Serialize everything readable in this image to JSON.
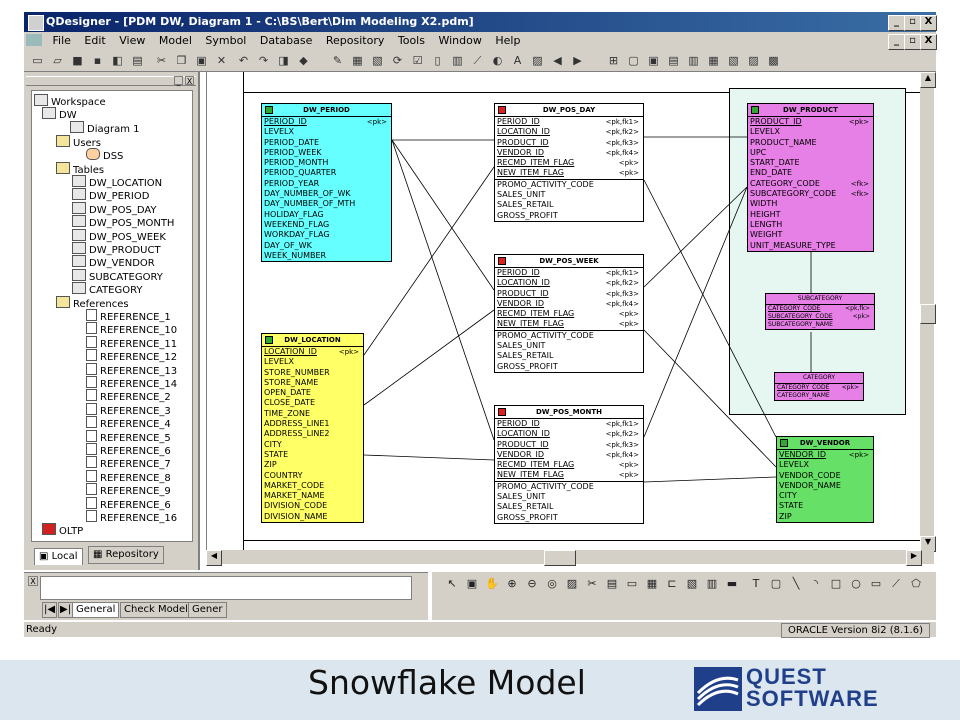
{
  "window": {
    "title": "QDesigner - [PDM DW, Diagram 1 - C:\\BS\\Bert\\Dim Modeling X2.pdm]",
    "buttons": [
      "_",
      "▫",
      "X"
    ]
  },
  "menu": [
    "File",
    "Edit",
    "View",
    "Model",
    "Symbol",
    "Database",
    "Repository",
    "Tools",
    "Window",
    "Help"
  ],
  "tree": {
    "workspace": "Workspace",
    "model": "DW",
    "diagram": "Diagram 1",
    "users_folder": "Users",
    "user": "DSS",
    "tables_folder": "Tables",
    "tables": [
      "DW_LOCATION",
      "DW_PERIOD",
      "DW_POS_DAY",
      "DW_POS_MONTH",
      "DW_POS_WEEK",
      "DW_PRODUCT",
      "DW_VENDOR",
      "SUBCATEGORY",
      "CATEGORY"
    ],
    "references_folder": "References",
    "references": [
      "REFERENCE_1",
      "REFERENCE_10",
      "REFERENCE_11",
      "REFERENCE_12",
      "REFERENCE_13",
      "REFERENCE_14",
      "REFERENCE_2",
      "REFERENCE_3",
      "REFERENCE_4",
      "REFERENCE_5",
      "REFERENCE_6",
      "REFERENCE_7",
      "REFERENCE_8",
      "REFERENCE_9",
      "REFERENCE_6",
      "REFERENCE_16"
    ],
    "oltp": "OLTP"
  },
  "panel_tabs": {
    "local": "Local",
    "repository": "Repository"
  },
  "bottom_tabs": [
    "General",
    "Check Model",
    "Gener"
  ],
  "status": {
    "left": "Ready",
    "right": "ORACLE Version 8i2 (8.1.6)"
  },
  "entities": {
    "period": {
      "name": "DW_PERIOD",
      "rows": [
        {
          "n": "PERIOD_ID",
          "k": "<pk>"
        },
        {
          "n": "LEVELX"
        },
        {
          "n": "PERIOD_DATE"
        },
        {
          "n": "PERIOD_WEEK"
        },
        {
          "n": "PERIOD_MONTH"
        },
        {
          "n": "PERIOD_QUARTER"
        },
        {
          "n": "PERIOD_YEAR"
        },
        {
          "n": "DAY_NUMBER_OF_WK"
        },
        {
          "n": "DAY_NUMBER_OF_MTH"
        },
        {
          "n": "HOLIDAY_FLAG"
        },
        {
          "n": "WEEKEND_FLAG"
        },
        {
          "n": "WORKDAY_FLAG"
        },
        {
          "n": "DAY_OF_WK"
        },
        {
          "n": "WEEK_NUMBER"
        }
      ]
    },
    "location": {
      "name": "DW_LOCATION",
      "rows": [
        {
          "n": "LOCATION_ID",
          "k": "<pk>"
        },
        {
          "n": "LEVELX"
        },
        {
          "n": "STORE_NUMBER"
        },
        {
          "n": "STORE_NAME"
        },
        {
          "n": "OPEN_DATE"
        },
        {
          "n": "CLOSE_DATE"
        },
        {
          "n": "TIME_ZONE"
        },
        {
          "n": "ADDRESS_LINE1"
        },
        {
          "n": "ADDRESS_LINE2"
        },
        {
          "n": "CITY"
        },
        {
          "n": "STATE"
        },
        {
          "n": "ZIP"
        },
        {
          "n": "COUNTRY"
        },
        {
          "n": "MARKET_CODE"
        },
        {
          "n": "MARKET_NAME"
        },
        {
          "n": "DIVISION_CODE"
        },
        {
          "n": "DIVISION_NAME"
        }
      ]
    },
    "pos_day": {
      "name": "DW_POS_DAY",
      "rows": [
        {
          "n": "PERIOD_ID",
          "k": "<pk,fk1>"
        },
        {
          "n": "LOCATION_ID",
          "k": "<pk,fk2>"
        },
        {
          "n": "PRODUCT_ID",
          "k": "<pk,fk3>"
        },
        {
          "n": "VENDOR_ID",
          "k": "<pk,fk4>"
        },
        {
          "n": "RECMD_ITEM_FLAG",
          "k": "<pk>"
        },
        {
          "n": "NEW_ITEM_FLAG",
          "k": "<pk>"
        },
        {
          "n": "PROMO_ACTIVITY_CODE"
        },
        {
          "n": "SALES_UNIT"
        },
        {
          "n": "SALES_RETAIL"
        },
        {
          "n": "GROSS_PROFIT"
        }
      ]
    },
    "pos_week": {
      "name": "DW_POS_WEEK",
      "rows": [
        {
          "n": "PERIOD_ID",
          "k": "<pk,fk1>"
        },
        {
          "n": "LOCATION_ID",
          "k": "<pk,fk2>"
        },
        {
          "n": "PRODUCT_ID",
          "k": "<pk,fk3>"
        },
        {
          "n": "VENDOR_ID",
          "k": "<pk,fk4>"
        },
        {
          "n": "RECMD_ITEM_FLAG",
          "k": "<pk>"
        },
        {
          "n": "NEW_ITEM_FLAG",
          "k": "<pk>"
        },
        {
          "n": "PROMO_ACTIVITY_CODE"
        },
        {
          "n": "SALES_UNIT"
        },
        {
          "n": "SALES_RETAIL"
        },
        {
          "n": "GROSS_PROFIT"
        }
      ]
    },
    "pos_month": {
      "name": "DW_POS_MONTH",
      "rows": [
        {
          "n": "PERIOD_ID",
          "k": "<pk,fk1>"
        },
        {
          "n": "LOCATION_ID",
          "k": "<pk,fk2>"
        },
        {
          "n": "PRODUCT_ID",
          "k": "<pk,fk3>"
        },
        {
          "n": "VENDOR_ID",
          "k": "<pk,fk4>"
        },
        {
          "n": "RECMD_ITEM_FLAG",
          "k": "<pk>"
        },
        {
          "n": "NEW_ITEM_FLAG",
          "k": "<pk>"
        },
        {
          "n": "PROMO_ACTIVITY_CODE"
        },
        {
          "n": "SALES_UNIT"
        },
        {
          "n": "SALES_RETAIL"
        },
        {
          "n": "GROSS_PROFIT"
        }
      ]
    },
    "product": {
      "name": "DW_PRODUCT",
      "rows": [
        {
          "n": "PRODUCT_ID",
          "k": "<pk>"
        },
        {
          "n": "LEVELX"
        },
        {
          "n": "PRODUCT_NAME"
        },
        {
          "n": "UPC"
        },
        {
          "n": "START_DATE"
        },
        {
          "n": "END_DATE"
        },
        {
          "n": "CATEGORY_CODE",
          "k": "<fk>"
        },
        {
          "n": "SUBCATEGORY_CODE",
          "k": "<fk>"
        },
        {
          "n": "WIDTH"
        },
        {
          "n": "HEIGHT"
        },
        {
          "n": "LENGTH"
        },
        {
          "n": "WEIGHT"
        },
        {
          "n": "UNIT_MEASURE_TYPE"
        }
      ]
    },
    "subcategory": {
      "name": "SUBCATEGORY",
      "rows": [
        {
          "n": "CATEGORY_CODE",
          "k": "<pk,fk>"
        },
        {
          "n": "SUBCATEGORY_CODE",
          "k": "<pk>"
        },
        {
          "n": "SUBCATEGORY_NAME"
        }
      ]
    },
    "category": {
      "name": "CATEGORY",
      "rows": [
        {
          "n": "CATEGORY_CODE",
          "k": "<pk>"
        },
        {
          "n": "CATEGORY_NAME"
        }
      ]
    },
    "vendor": {
      "name": "DW_VENDOR",
      "rows": [
        {
          "n": "VENDOR_ID",
          "k": "<pk>"
        },
        {
          "n": "LEVELX"
        },
        {
          "n": "VENDOR_CODE"
        },
        {
          "n": "VENDOR_NAME"
        },
        {
          "n": "CITY"
        },
        {
          "n": "STATE"
        },
        {
          "n": "ZIP"
        }
      ]
    }
  },
  "colors": {
    "period": "#66ffff",
    "location": "#ffff66",
    "pos": "#ffffff",
    "product": "#e680e6",
    "subcategory": "#e680e6",
    "category": "#e680e6",
    "vendor": "#66e066",
    "snowflake_bg": "#e6f7f2"
  },
  "footer": {
    "title": "Snowflake Model",
    "logo_line1": "QUEST",
    "logo_line2": "SOFTWARE"
  }
}
